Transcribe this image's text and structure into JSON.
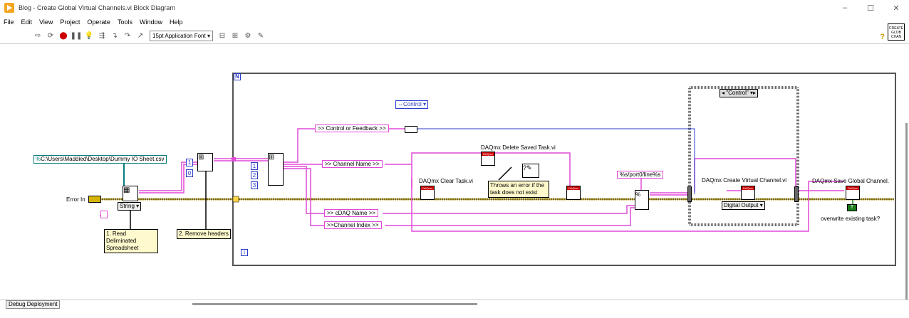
{
  "window": {
    "title": "Blog - Create Global Virtual Channels.vi Block Diagram",
    "controls": [
      "–",
      "☐",
      "✕"
    ]
  },
  "menu": [
    "File",
    "Edit",
    "View",
    "Project",
    "Operate",
    "Tools",
    "Window",
    "Help"
  ],
  "toolbar": {
    "font": "15pt Application Font"
  },
  "vi_icon_text": "CREATE GLOB CHAN",
  "diagram": {
    "loop_count_label": "N",
    "loop_index_label": "i",
    "file_path": "C:\\Users\\Maddied\\Desktop\\Dummy IO Sheet.csv",
    "error_in": "Error In",
    "string_ring": "String",
    "const_1": "1",
    "const_0": "0",
    "idx_1": "1",
    "idx_2": "2",
    "idx_3": "3",
    "control_enum": "Control",
    "tag_control_feedback": ">> Control or Feedback >>",
    "tag_channel_name": ">> Channel Name >>",
    "tag_cdaq_name": ">> cDAQ Name >>",
    "tag_channel_index": ">>Channel Index >>",
    "clear_task": "DAQmx Clear Task.vi",
    "delete_task": "DAQmx Delete Saved Task.vi",
    "note_throws": "Throws an error if the task does not exist",
    "format_string": "%s/port0/line%s",
    "case_selector": "\"Control\"",
    "create_channel": "DAQmx Create Virtual Channel.vi",
    "digital_output": "Digital Output",
    "save_channel": "DAQmx Save Global Channel.",
    "overwrite": "overwrite existing task?",
    "note_read": "1. Read Deliminated Spreadsheet",
    "note_remove": "2. Remove headers"
  },
  "status": {
    "tab": "Debug Deployment"
  }
}
